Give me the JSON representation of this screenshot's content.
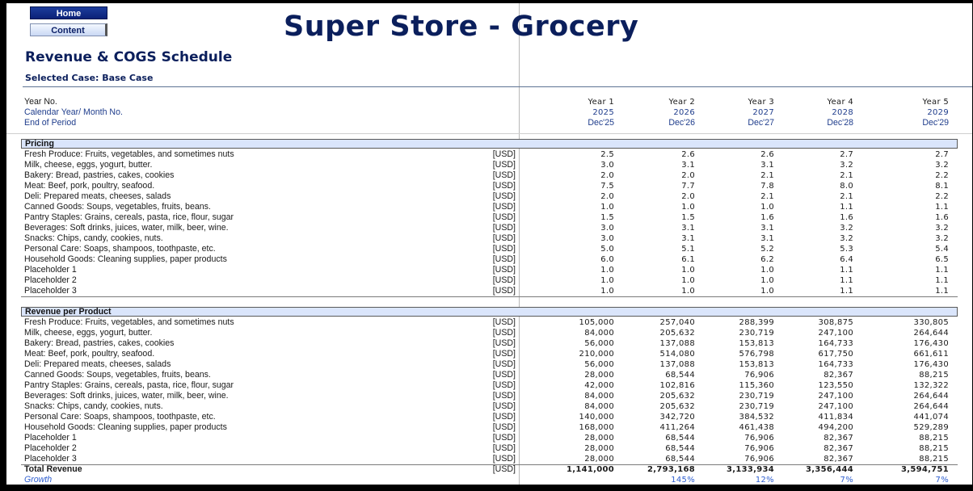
{
  "nav": {
    "home_label": "Home",
    "content_label": "Content"
  },
  "header": {
    "title": "Super Store - Grocery",
    "subtitle": "Revenue & COGS Schedule",
    "selected_case": "Selected Case: Base Case"
  },
  "timeline": {
    "year_no_label": "Year No.",
    "calendar_label": "Calendar Year/ Month No.",
    "period_label": "End of Period",
    "years": [
      "Year 1",
      "Year 2",
      "Year 3",
      "Year 4",
      "Year 5"
    ],
    "calendar": [
      "2025",
      "2026",
      "2027",
      "2028",
      "2029"
    ],
    "periods": [
      "Dec'25",
      "Dec'26",
      "Dec'27",
      "Dec'28",
      "Dec'29"
    ]
  },
  "pricing": {
    "title": "Pricing",
    "rows": [
      {
        "label": "Fresh Produce: Fruits, vegetables, and sometimes nuts",
        "unit": "[USD]",
        "values": [
          "2.5",
          "2.6",
          "2.6",
          "2.7",
          "2.7"
        ]
      },
      {
        "label": "Milk, cheese, eggs, yogurt, butter.",
        "unit": "[USD]",
        "values": [
          "3.0",
          "3.1",
          "3.1",
          "3.2",
          "3.2"
        ]
      },
      {
        "label": "Bakery: Bread, pastries, cakes, cookies",
        "unit": "[USD]",
        "values": [
          "2.0",
          "2.0",
          "2.1",
          "2.1",
          "2.2"
        ]
      },
      {
        "label": "Meat: Beef, pork, poultry, seafood.",
        "unit": "[USD]",
        "values": [
          "7.5",
          "7.7",
          "7.8",
          "8.0",
          "8.1"
        ]
      },
      {
        "label": "Deli: Prepared meats, cheeses, salads",
        "unit": "[USD]",
        "values": [
          "2.0",
          "2.0",
          "2.1",
          "2.1",
          "2.2"
        ]
      },
      {
        "label": "Canned Goods: Soups, vegetables, fruits, beans.",
        "unit": "[USD]",
        "values": [
          "1.0",
          "1.0",
          "1.0",
          "1.1",
          "1.1"
        ]
      },
      {
        "label": "Pantry Staples: Grains, cereals, pasta, rice, flour, sugar",
        "unit": "[USD]",
        "values": [
          "1.5",
          "1.5",
          "1.6",
          "1.6",
          "1.6"
        ]
      },
      {
        "label": "Beverages: Soft drinks, juices, water, milk, beer, wine.",
        "unit": "[USD]",
        "values": [
          "3.0",
          "3.1",
          "3.1",
          "3.2",
          "3.2"
        ]
      },
      {
        "label": "Snacks: Chips, candy, cookies, nuts.",
        "unit": "[USD]",
        "values": [
          "3.0",
          "3.1",
          "3.1",
          "3.2",
          "3.2"
        ]
      },
      {
        "label": "Personal Care: Soaps, shampoos, toothpaste, etc.",
        "unit": "[USD]",
        "values": [
          "5.0",
          "5.1",
          "5.2",
          "5.3",
          "5.4"
        ]
      },
      {
        "label": "Household Goods: Cleaning supplies, paper products",
        "unit": "[USD]",
        "values": [
          "6.0",
          "6.1",
          "6.2",
          "6.4",
          "6.5"
        ]
      },
      {
        "label": "Placeholder 1",
        "unit": "[USD]",
        "values": [
          "1.0",
          "1.0",
          "1.0",
          "1.1",
          "1.1"
        ]
      },
      {
        "label": "Placeholder 2",
        "unit": "[USD]",
        "values": [
          "1.0",
          "1.0",
          "1.0",
          "1.1",
          "1.1"
        ]
      },
      {
        "label": "Placeholder 3",
        "unit": "[USD]",
        "values": [
          "1.0",
          "1.0",
          "1.0",
          "1.1",
          "1.1"
        ]
      }
    ]
  },
  "revenue": {
    "title": "Revenue per Product",
    "rows": [
      {
        "label": "Fresh Produce: Fruits, vegetables, and sometimes nuts",
        "unit": "[USD]",
        "values": [
          "105,000",
          "257,040",
          "288,399",
          "308,875",
          "330,805"
        ]
      },
      {
        "label": "Milk, cheese, eggs, yogurt, butter.",
        "unit": "[USD]",
        "values": [
          "84,000",
          "205,632",
          "230,719",
          "247,100",
          "264,644"
        ]
      },
      {
        "label": "Bakery: Bread, pastries, cakes, cookies",
        "unit": "[USD]",
        "values": [
          "56,000",
          "137,088",
          "153,813",
          "164,733",
          "176,430"
        ]
      },
      {
        "label": "Meat: Beef, pork, poultry, seafood.",
        "unit": "[USD]",
        "values": [
          "210,000",
          "514,080",
          "576,798",
          "617,750",
          "661,611"
        ]
      },
      {
        "label": "Deli: Prepared meats, cheeses, salads",
        "unit": "[USD]",
        "values": [
          "56,000",
          "137,088",
          "153,813",
          "164,733",
          "176,430"
        ]
      },
      {
        "label": "Canned Goods: Soups, vegetables, fruits, beans.",
        "unit": "[USD]",
        "values": [
          "28,000",
          "68,544",
          "76,906",
          "82,367",
          "88,215"
        ]
      },
      {
        "label": "Pantry Staples: Grains, cereals, pasta, rice, flour, sugar",
        "unit": "[USD]",
        "values": [
          "42,000",
          "102,816",
          "115,360",
          "123,550",
          "132,322"
        ]
      },
      {
        "label": "Beverages: Soft drinks, juices, water, milk, beer, wine.",
        "unit": "[USD]",
        "values": [
          "84,000",
          "205,632",
          "230,719",
          "247,100",
          "264,644"
        ]
      },
      {
        "label": "Snacks: Chips, candy, cookies, nuts.",
        "unit": "[USD]",
        "values": [
          "84,000",
          "205,632",
          "230,719",
          "247,100",
          "264,644"
        ]
      },
      {
        "label": "Personal Care: Soaps, shampoos, toothpaste, etc.",
        "unit": "[USD]",
        "values": [
          "140,000",
          "342,720",
          "384,532",
          "411,834",
          "441,074"
        ]
      },
      {
        "label": "Household Goods: Cleaning supplies, paper products",
        "unit": "[USD]",
        "values": [
          "168,000",
          "411,264",
          "461,438",
          "494,200",
          "529,289"
        ]
      },
      {
        "label": "Placeholder 1",
        "unit": "[USD]",
        "values": [
          "28,000",
          "68,544",
          "76,906",
          "82,367",
          "88,215"
        ]
      },
      {
        "label": "Placeholder 2",
        "unit": "[USD]",
        "values": [
          "28,000",
          "68,544",
          "76,906",
          "82,367",
          "88,215"
        ]
      },
      {
        "label": "Placeholder 3",
        "unit": "[USD]",
        "values": [
          "28,000",
          "68,544",
          "76,906",
          "82,367",
          "88,215"
        ]
      }
    ],
    "total": {
      "label": "Total Revenue",
      "unit": "[USD]",
      "values": [
        "1,141,000",
        "2,793,168",
        "3,133,934",
        "3,356,444",
        "3,594,751"
      ]
    },
    "growth": {
      "label": "Growth",
      "values": [
        "",
        "145%",
        "12%",
        "7%",
        "7%"
      ]
    }
  }
}
